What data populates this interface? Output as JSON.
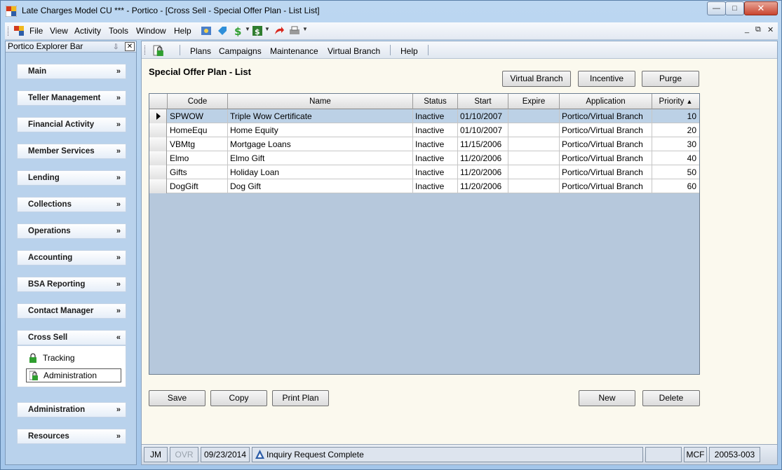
{
  "window": {
    "title": "Late Charges Model CU *** - Portico - [Cross Sell - Special Offer Plan - List List]",
    "min_glyph": "—",
    "max_glyph": "□",
    "close_glyph": "✕"
  },
  "menubar": {
    "items": [
      "File",
      "View",
      "Activity",
      "Tools",
      "Window",
      "Help"
    ],
    "mdi_controls": [
      "_",
      "⧉",
      "✕"
    ]
  },
  "explorer": {
    "title": "Portico Explorer Bar",
    "close_glyph": "✕",
    "pin_glyph": "⇩",
    "nav": [
      {
        "label": "Main",
        "chevron": "»"
      },
      {
        "label": "Teller Management",
        "chevron": "»"
      },
      {
        "label": "Financial Activity",
        "chevron": "»"
      },
      {
        "label": "Member Services",
        "chevron": "»"
      },
      {
        "label": "Lending",
        "chevron": "»"
      },
      {
        "label": "Collections",
        "chevron": "»"
      },
      {
        "label": "Operations",
        "chevron": "»"
      },
      {
        "label": "Accounting",
        "chevron": "»"
      },
      {
        "label": "BSA Reporting",
        "chevron": "»"
      },
      {
        "label": "Contact Manager",
        "chevron": "»"
      },
      {
        "label": "Cross Sell",
        "chevron": "«"
      },
      {
        "label": "Administration",
        "chevron": "»"
      },
      {
        "label": "Resources",
        "chevron": "»"
      }
    ],
    "cross_sell_items": [
      "Tracking",
      "Administration"
    ],
    "accent": "#2f9e2f"
  },
  "content_toolbar": {
    "items": [
      "Plans",
      "Campaigns",
      "Maintenance",
      "Virtual Branch",
      "Help"
    ]
  },
  "page": {
    "title": "Special Offer Plan - List",
    "top_buttons": [
      "Virtual Branch",
      "Incentive",
      "Purge"
    ],
    "bottom_buttons": [
      "Save",
      "Copy",
      "Print Plan",
      "New",
      "Delete"
    ]
  },
  "grid": {
    "columns": [
      "Code",
      "Name",
      "Status",
      "Start",
      "Expire",
      "Application",
      "Priority"
    ],
    "sort_indicator": "▲",
    "rows": [
      {
        "code": "SPWOW",
        "name": "Triple Wow Certificate",
        "status": "Inactive",
        "start": "01/10/2007",
        "expire": "",
        "application": "Portico/Virtual Branch",
        "priority": "10"
      },
      {
        "code": "HomeEqu",
        "name": "Home Equity",
        "status": "Inactive",
        "start": "01/10/2007",
        "expire": "",
        "application": "Portico/Virtual Branch",
        "priority": "20"
      },
      {
        "code": "VBMtg",
        "name": "Mortgage Loans",
        "status": "Inactive",
        "start": "11/15/2006",
        "expire": "",
        "application": "Portico/Virtual Branch",
        "priority": "30"
      },
      {
        "code": "Elmo",
        "name": "Elmo Gift",
        "status": "Inactive",
        "start": "11/20/2006",
        "expire": "",
        "application": "Portico/Virtual Branch",
        "priority": "40"
      },
      {
        "code": "Gifts",
        "name": "Holiday Loan",
        "status": "Inactive",
        "start": "11/20/2006",
        "expire": "",
        "application": "Portico/Virtual Branch",
        "priority": "50"
      },
      {
        "code": "DogGift",
        "name": "Dog Gift",
        "status": "Inactive",
        "start": "11/20/2006",
        "expire": "",
        "application": "Portico/Virtual Branch",
        "priority": "60"
      }
    ]
  },
  "statusbar": {
    "user": "JM",
    "ovr": "OVR",
    "date": "09/23/2014",
    "message": "Inquiry Request Complete",
    "blank": "",
    "mode": "MCF",
    "session": "20053-003"
  }
}
